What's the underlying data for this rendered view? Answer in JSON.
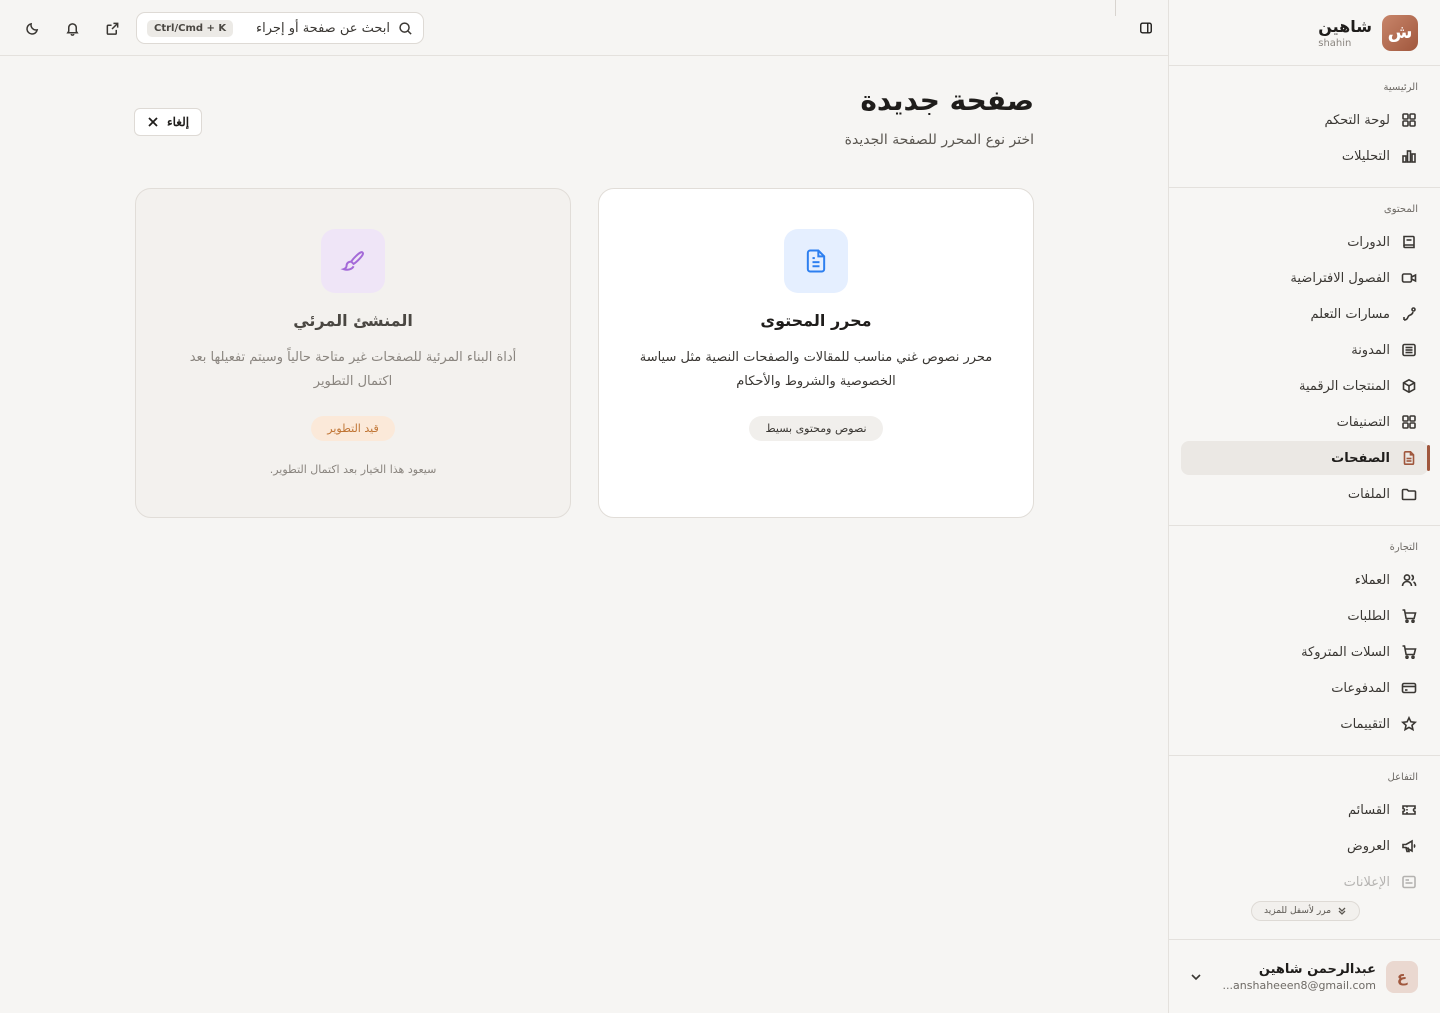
{
  "brand": {
    "logo_letter": "ش",
    "name": "شاهين",
    "sub": "shahin"
  },
  "nav": {
    "sections": [
      {
        "title": "الرئيسية",
        "items": [
          {
            "label": "لوحة التحكم",
            "icon": "dashboard-icon"
          },
          {
            "label": "التحليلات",
            "icon": "analytics-icon"
          }
        ]
      },
      {
        "title": "المحتوى",
        "items": [
          {
            "label": "الدورات",
            "icon": "book-icon"
          },
          {
            "label": "الفصول الافتراضية",
            "icon": "video-icon"
          },
          {
            "label": "مسارات التعلم",
            "icon": "route-icon"
          },
          {
            "label": "المدونة",
            "icon": "blog-icon"
          },
          {
            "label": "المنتجات الرقمية",
            "icon": "package-icon"
          },
          {
            "label": "التصنيفات",
            "icon": "categories-icon"
          },
          {
            "label": "الصفحات",
            "icon": "page-icon",
            "active": true
          },
          {
            "label": "الملفات",
            "icon": "folder-icon"
          }
        ]
      },
      {
        "title": "التجارة",
        "items": [
          {
            "label": "العملاء",
            "icon": "users-icon"
          },
          {
            "label": "الطلبات",
            "icon": "cart-icon"
          },
          {
            "label": "السلات المتروكة",
            "icon": "abandoned-cart-icon"
          },
          {
            "label": "المدفوعات",
            "icon": "card-icon"
          },
          {
            "label": "التقييمات",
            "icon": "star-icon"
          }
        ]
      },
      {
        "title": "التفاعل",
        "items": [
          {
            "label": "القسائم",
            "icon": "ticket-icon"
          },
          {
            "label": "العروض",
            "icon": "megaphone-icon"
          },
          {
            "label": "الإعلانات",
            "icon": "ads-icon"
          }
        ]
      }
    ],
    "scroll_hint": "مرر لأسفل للمزيد"
  },
  "user": {
    "avatar_letter": "ع",
    "name": "عبدالرحمن شاهين",
    "email": "anshaheeen8@gmail.com..."
  },
  "topbar": {
    "search_placeholder": "ابحث عن صفحة أو إجراء",
    "shortcut": "Ctrl/Cmd + K"
  },
  "main": {
    "title": "صفحة جديدة",
    "subtitle": "اختر نوع المحرر للصفحة الجديدة",
    "cancel_label": "إلغاء",
    "cards": {
      "content": {
        "title": "محرر المحتوى",
        "desc": "محرر نصوص غني مناسب للمقالات والصفحات النصية مثل سياسة الخصوصية والشروط والأحكام",
        "tag": "نصوص ومحتوى بسيط"
      },
      "visual": {
        "title": "المنشئ المرئي",
        "desc": "أداة البناء المرئية للصفحات غير متاحة حالياً وسيتم تفعيلها بعد اكتمال التطوير",
        "tag": "قيد التطوير",
        "note": "سيعود هذا الخيار بعد اكتمال التطوير."
      }
    }
  },
  "colors": {
    "accent": "#a0573d",
    "blue": "#2d7ff0",
    "purple": "#a46ad8"
  }
}
